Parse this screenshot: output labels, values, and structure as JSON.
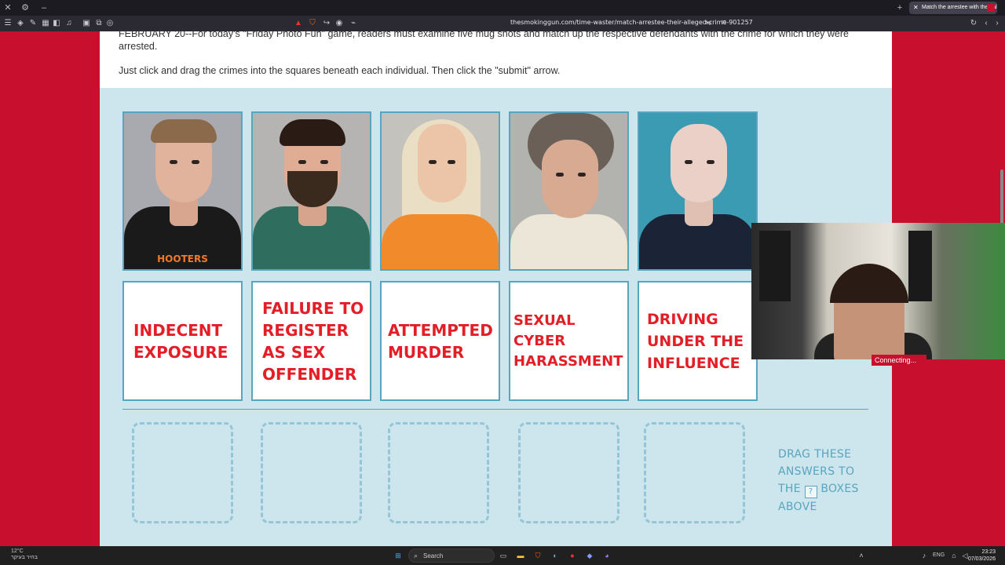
{
  "browser": {
    "url": "thesmokinggun.com/time-waster/match-arrestee-their-alleged-crime-901257",
    "tab_title": "Match the arrestee with their al"
  },
  "article": {
    "intro_line": "FEBRUARY 20--For today's \"Friday Photo Fun\" game, readers must examine five mug shots and match up the respective defendants with the crime for which they were arrested.",
    "instruction": "Just click and drag the crimes into the squares beneath each individual. Then click the \"submit\" arrow."
  },
  "game": {
    "mugshots": [
      {
        "shirt_text": "HOOTERS"
      },
      {
        "shirt_text": ""
      },
      {
        "shirt_text": ""
      },
      {
        "shirt_text": ""
      },
      {
        "shirt_text": ""
      }
    ],
    "crimes": [
      "INDECENT EXPOSURE",
      "FAILURE TO REGISTER AS SEX OFFENDER",
      "ATTEMPTED MURDER",
      "SEXUAL CYBER HARASSMENT",
      "DRIVING UNDER THE INFLUENCE"
    ],
    "hint_line1": "DRAG THESE",
    "hint_line2": "ANSWERS TO",
    "hint_line3a": "THE",
    "hint_icon": "?",
    "hint_line3b": "BOXES",
    "hint_line4": "ABOVE"
  },
  "overlay": {
    "status": "Connecting..."
  },
  "taskbar": {
    "search_placeholder": "Search",
    "time": "23:23",
    "date": "07/03/2026",
    "weather_temp": "12°C",
    "weather_label": "בהיר בעיקר",
    "lang": "ENG"
  },
  "colors": {
    "page_bg": "#c8102e",
    "game_bg": "#cde5ec",
    "crime_text": "#e41e26",
    "accent": "#58a5c0"
  }
}
